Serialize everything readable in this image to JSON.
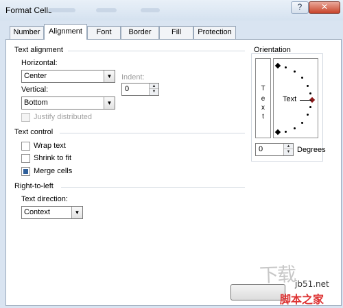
{
  "window": {
    "title": "Format Cells",
    "help_glyph": "?",
    "close_glyph": "✕"
  },
  "tabs": [
    {
      "label": "Number"
    },
    {
      "label": "Alignment"
    },
    {
      "label": "Font"
    },
    {
      "label": "Border"
    },
    {
      "label": "Fill"
    },
    {
      "label": "Protection"
    }
  ],
  "text_alignment": {
    "section_label": "Text alignment",
    "horizontal_label": "Horizontal:",
    "horizontal_value": "Center",
    "indent_label": "Indent:",
    "indent_value": "0",
    "vertical_label": "Vertical:",
    "vertical_value": "Bottom",
    "justify_distributed_label": "Justify distributed"
  },
  "text_control": {
    "section_label": "Text control",
    "wrap_text_label": "Wrap text",
    "shrink_to_fit_label": "Shrink to fit",
    "merge_cells_label": "Merge cells",
    "merge_cells_checked": true
  },
  "right_to_left": {
    "section_label": "Right-to-left",
    "text_direction_label": "Text direction:",
    "text_direction_value": "Context"
  },
  "orientation": {
    "section_label": "Orientation",
    "vertical_text_letters": [
      "T",
      "e",
      "x",
      "t"
    ],
    "dial_text": "Text",
    "degrees_value": "0",
    "degrees_label": "Degrees"
  },
  "watermark": {
    "site": "jb51.net",
    "line2": "脚本之家",
    "logo": "下载"
  }
}
